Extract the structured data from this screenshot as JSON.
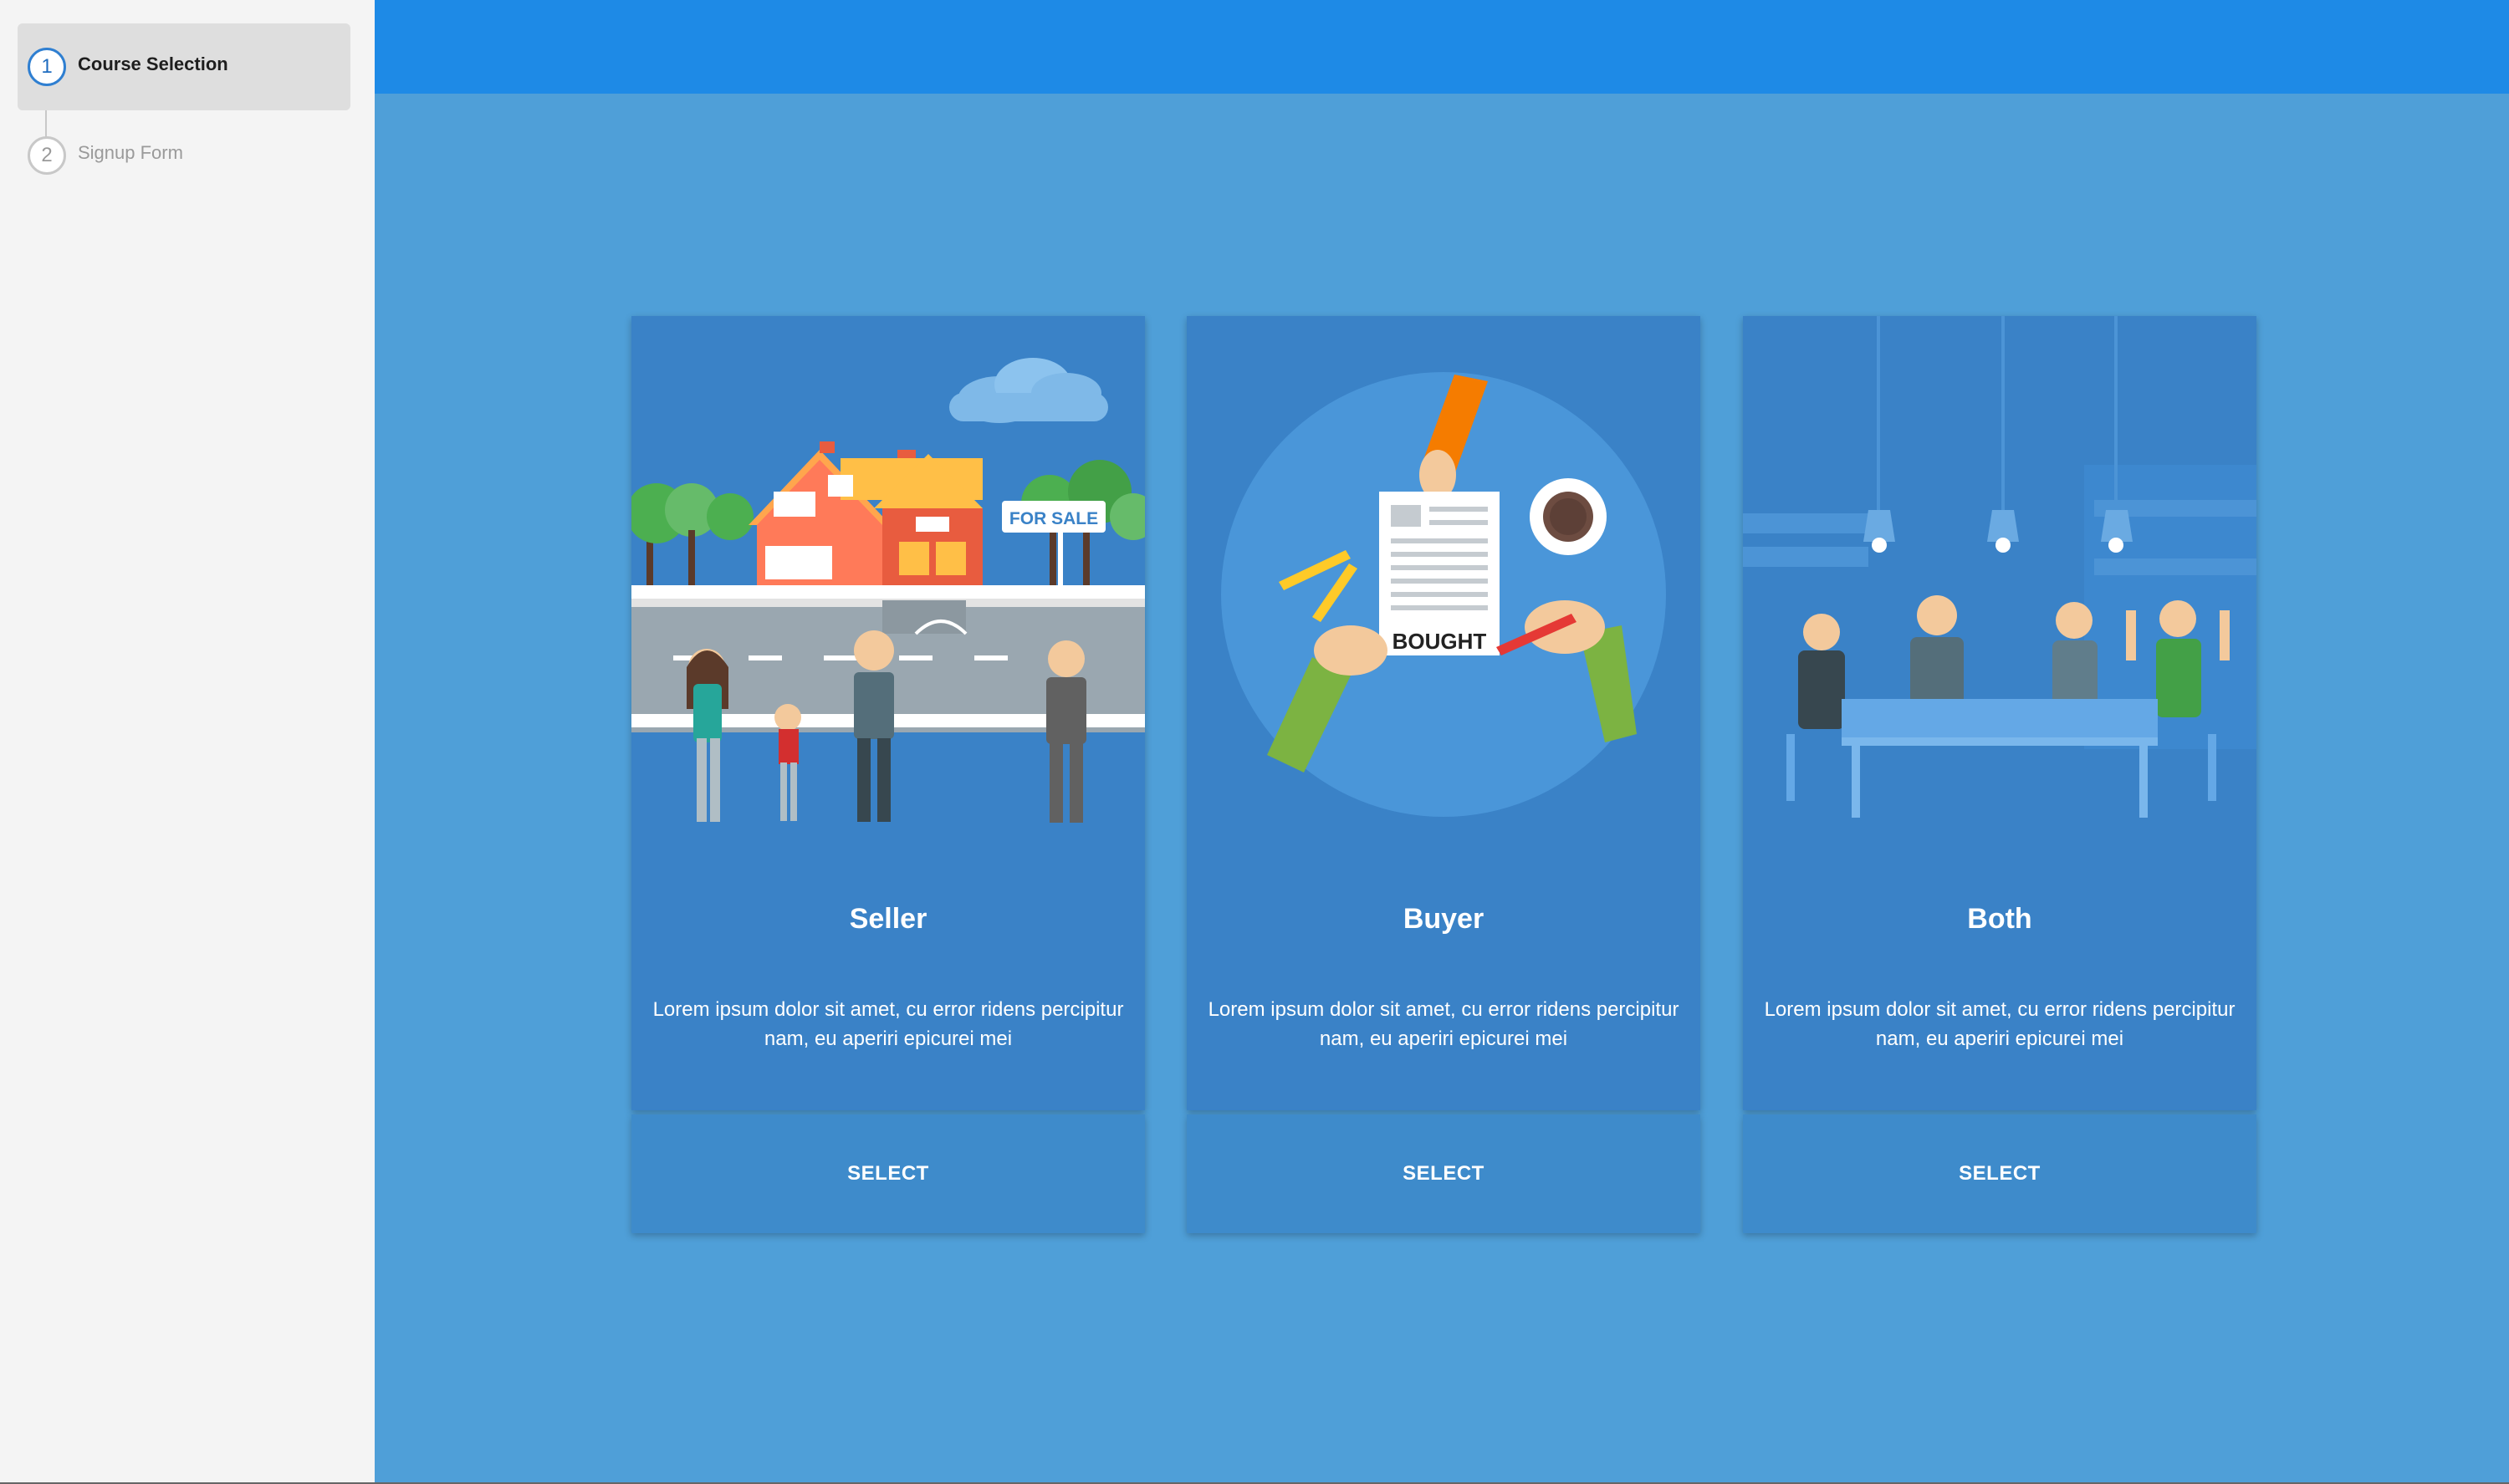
{
  "stepper": {
    "steps": [
      {
        "number": "1",
        "label": "Course Selection"
      },
      {
        "number": "2",
        "label": "Signup Form"
      }
    ]
  },
  "cards": [
    {
      "title": "Seller",
      "description": "Lorem ipsum dolor sit amet, cu error ridens percipitur nam, eu aperiri epicurei mei",
      "button_label": "SELECT",
      "illustration_sign": "FOR SALE"
    },
    {
      "title": "Buyer",
      "description": "Lorem ipsum dolor sit amet, cu error ridens percipitur nam, eu aperiri epicurei mei",
      "button_label": "SELECT",
      "illustration_sign": "BOUGHT"
    },
    {
      "title": "Both",
      "description": "Lorem ipsum dolor sit amet, cu error ridens percipitur nam, eu aperiri epicurei mei",
      "button_label": "SELECT"
    }
  ],
  "colors": {
    "topbar": "#1e8ae6",
    "background": "#4f9fd8",
    "card": "#3a82c7",
    "sidebar": "#f4f4f4",
    "active_step": "#2f7fd1"
  }
}
